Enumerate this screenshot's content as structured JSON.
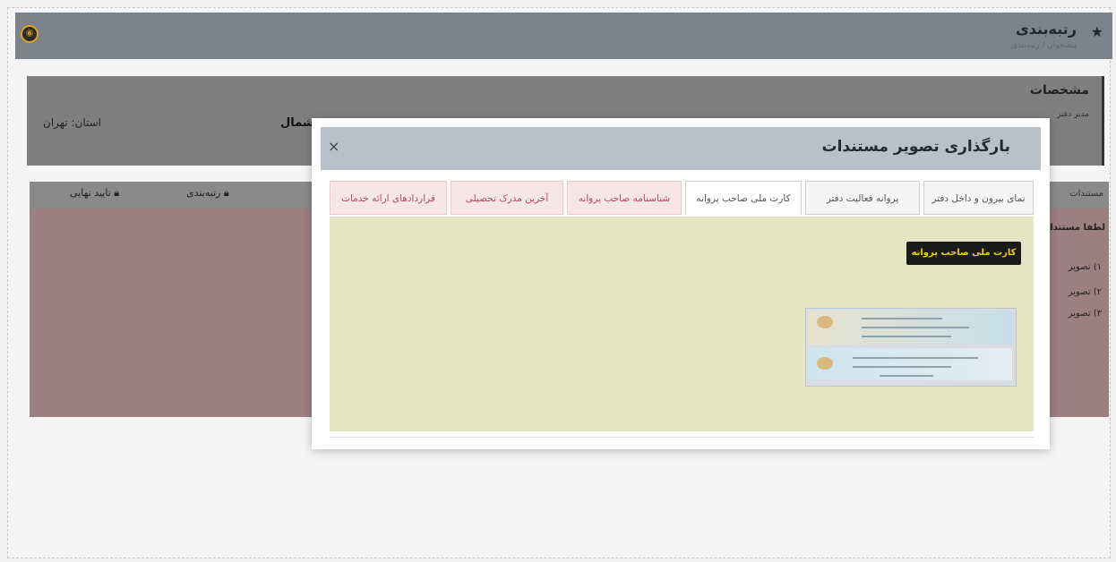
{
  "topbar": {
    "title": "رتبه‌بندی",
    "subtitle": "پیشخوان / رتبه‌بندی",
    "logo_glyph": "⑥"
  },
  "spec_card": {
    "title": "مشخصات",
    "subtitle": "مدیر دفتر",
    "province_label": "استان:",
    "province_value": "تهران",
    "district_value": "شمال"
  },
  "actions": {
    "final_approve": "تایید نهایی",
    "ranking": "رتبه‌بندی",
    "partial_left": "...",
    "partial_right": "مستندات"
  },
  "info": {
    "heading": "لطفا مستندات",
    "items": [
      "۱) تصویر",
      "۲) تصویر",
      "۳) تصویر"
    ]
  },
  "modal": {
    "title": "بارگذاری تصویر مستندات",
    "close_icon": "×",
    "tabs": [
      {
        "label": "نمای بیرون و داخل دفتر",
        "style": "normal"
      },
      {
        "label": "پروانه فعالیت دفتر",
        "style": "normal"
      },
      {
        "label": "کارت ملی صاحب پروانه",
        "style": "active"
      },
      {
        "label": "شناسنامه صاحب پروانه",
        "style": "pink"
      },
      {
        "label": "آخرین مدرک تحصیلی",
        "style": "pink"
      },
      {
        "label": "قراردادهای ارائه خدمات",
        "style": "pink"
      }
    ],
    "tooltip": "کارت ملی صاحب پروانه",
    "image_alt": "تصویر کارت ملی"
  },
  "colors": {
    "overlay_gray": "#7d838a",
    "modal_header": "#b8c0c8",
    "content_bg": "#e4e5c3",
    "tooltip_text": "#e8d200",
    "pink_tab": "#b04a5a"
  }
}
